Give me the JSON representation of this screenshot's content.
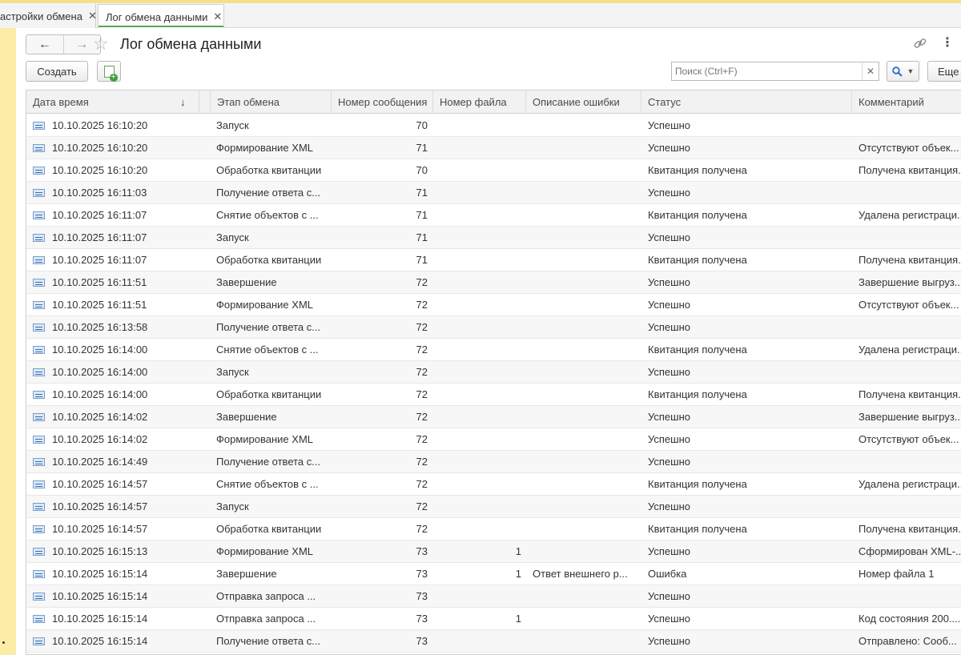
{
  "tabs": [
    {
      "label": "астройки обмена",
      "active": false
    },
    {
      "label": "Лог обмена данными",
      "active": true
    }
  ],
  "form": {
    "title": "Лог обмена данными",
    "create_label": "Создать",
    "search_placeholder": "Поиск (Ctrl+F)",
    "more_label": "Еще"
  },
  "columns": {
    "date": "Дата время",
    "stage": "Этап обмена",
    "message_no": "Номер сообщения",
    "file_no": "Номер файла",
    "error": "Описание ошибки",
    "status": "Статус",
    "comment": "Комментарий"
  },
  "icons": {
    "back": "arrow-left-icon",
    "forward": "arrow-right-icon",
    "favorite": "star-icon",
    "link": "link-icon",
    "menu": "more-vertical-icon",
    "add": "add-document-icon",
    "search": "search-icon",
    "row": "log-record-icon"
  },
  "colors": {
    "frame": "#fbeda5",
    "active_tab_underline": "#53a653",
    "search_button": "#2a6fc9"
  },
  "rows": [
    {
      "date": "10.10.2025 16:10:20",
      "stage": "Запуск",
      "message_no": "70",
      "file_no": "",
      "error": "",
      "status": "Успешно",
      "comment": ""
    },
    {
      "date": "10.10.2025 16:10:20",
      "stage": "Формирование XML",
      "message_no": "71",
      "file_no": "",
      "error": "",
      "status": "Успешно",
      "comment": "Отсутствуют объек..."
    },
    {
      "date": "10.10.2025 16:10:20",
      "stage": "Обработка квитанции",
      "message_no": "70",
      "file_no": "",
      "error": "",
      "status": "Квитанция получена",
      "comment": "Получена квитанция..."
    },
    {
      "date": "10.10.2025 16:11:03",
      "stage": "Получение ответа с...",
      "message_no": "71",
      "file_no": "",
      "error": "",
      "status": "Успешно",
      "comment": ""
    },
    {
      "date": "10.10.2025 16:11:07",
      "stage": "Снятие объектов с ...",
      "message_no": "71",
      "file_no": "",
      "error": "",
      "status": "Квитанция получена",
      "comment": "Удалена регистраци..."
    },
    {
      "date": "10.10.2025 16:11:07",
      "stage": "Запуск",
      "message_no": "71",
      "file_no": "",
      "error": "",
      "status": "Успешно",
      "comment": ""
    },
    {
      "date": "10.10.2025 16:11:07",
      "stage": "Обработка квитанции",
      "message_no": "71",
      "file_no": "",
      "error": "",
      "status": "Квитанция получена",
      "comment": "Получена квитанция..."
    },
    {
      "date": "10.10.2025 16:11:51",
      "stage": "Завершение",
      "message_no": "72",
      "file_no": "",
      "error": "",
      "status": "Успешно",
      "comment": "Завершение выгруз..."
    },
    {
      "date": "10.10.2025 16:11:51",
      "stage": "Формирование XML",
      "message_no": "72",
      "file_no": "",
      "error": "",
      "status": "Успешно",
      "comment": "Отсутствуют объек..."
    },
    {
      "date": "10.10.2025 16:13:58",
      "stage": "Получение ответа с...",
      "message_no": "72",
      "file_no": "",
      "error": "",
      "status": "Успешно",
      "comment": ""
    },
    {
      "date": "10.10.2025 16:14:00",
      "stage": "Снятие объектов с ...",
      "message_no": "72",
      "file_no": "",
      "error": "",
      "status": "Квитанция получена",
      "comment": "Удалена регистраци..."
    },
    {
      "date": "10.10.2025 16:14:00",
      "stage": "Запуск",
      "message_no": "72",
      "file_no": "",
      "error": "",
      "status": "Успешно",
      "comment": ""
    },
    {
      "date": "10.10.2025 16:14:00",
      "stage": "Обработка квитанции",
      "message_no": "72",
      "file_no": "",
      "error": "",
      "status": "Квитанция получена",
      "comment": "Получена квитанция..."
    },
    {
      "date": "10.10.2025 16:14:02",
      "stage": "Завершение",
      "message_no": "72",
      "file_no": "",
      "error": "",
      "status": "Успешно",
      "comment": "Завершение выгруз..."
    },
    {
      "date": "10.10.2025 16:14:02",
      "stage": "Формирование XML",
      "message_no": "72",
      "file_no": "",
      "error": "",
      "status": "Успешно",
      "comment": "Отсутствуют объек..."
    },
    {
      "date": "10.10.2025 16:14:49",
      "stage": "Получение ответа с...",
      "message_no": "72",
      "file_no": "",
      "error": "",
      "status": "Успешно",
      "comment": ""
    },
    {
      "date": "10.10.2025 16:14:57",
      "stage": "Снятие объектов с ...",
      "message_no": "72",
      "file_no": "",
      "error": "",
      "status": "Квитанция получена",
      "comment": "Удалена регистраци..."
    },
    {
      "date": "10.10.2025 16:14:57",
      "stage": "Запуск",
      "message_no": "72",
      "file_no": "",
      "error": "",
      "status": "Успешно",
      "comment": ""
    },
    {
      "date": "10.10.2025 16:14:57",
      "stage": "Обработка квитанции",
      "message_no": "72",
      "file_no": "",
      "error": "",
      "status": "Квитанция получена",
      "comment": "Получена квитанция..."
    },
    {
      "date": "10.10.2025 16:15:13",
      "stage": "Формирование XML",
      "message_no": "73",
      "file_no": "1",
      "error": "",
      "status": "Успешно",
      "comment": "Сформирован XML-..."
    },
    {
      "date": "10.10.2025 16:15:14",
      "stage": "Завершение",
      "message_no": "73",
      "file_no": "1",
      "error": "Ответ внешнего р...",
      "status": "Ошибка",
      "comment": "Номер файла 1"
    },
    {
      "date": "10.10.2025 16:15:14",
      "stage": "Отправка запроса ...",
      "message_no": "73",
      "file_no": "",
      "error": "",
      "status": "Успешно",
      "comment": ""
    },
    {
      "date": "10.10.2025 16:15:14",
      "stage": "Отправка запроса ...",
      "message_no": "73",
      "file_no": "1",
      "error": "",
      "status": "Успешно",
      "comment": "Код состояния 200...."
    },
    {
      "date": "10.10.2025 16:15:14",
      "stage": "Получение ответа с...",
      "message_no": "73",
      "file_no": "",
      "error": "",
      "status": "Успешно",
      "comment": "Отправлено: Сооб..."
    }
  ]
}
